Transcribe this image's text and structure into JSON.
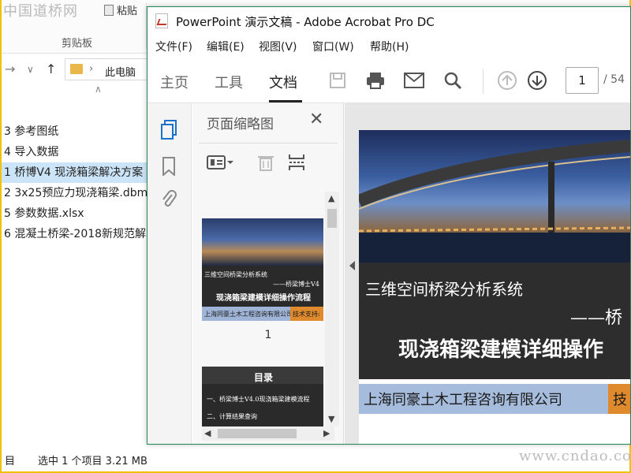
{
  "explorer": {
    "watermark_top": "中国道桥网",
    "ribbon_paste": "粘贴",
    "ribbon_group": "剪贴板",
    "address_path": "此电脑",
    "files": [
      {
        "name": "3 参考图纸",
        "selected": false
      },
      {
        "name": "4 导入数据",
        "selected": false
      },
      {
        "name": "1 桥博V4 现浇箱梁解决方案",
        "selected": true
      },
      {
        "name": "2 3x25预应力现浇箱梁.dbm",
        "selected": false
      },
      {
        "name": "5 参数数据.xlsx",
        "selected": false
      },
      {
        "name": "6 混凝土桥梁-2018新规范解",
        "selected": false
      }
    ],
    "status_left": "目",
    "status_selection": "选中 1 个项目  3.21 MB",
    "watermark_bottom": "www.cndao.com"
  },
  "acrobat": {
    "title": "PowerPoint 演示文稿 - Adobe Acrobat Pro DC",
    "menu": [
      "文件(F)",
      "编辑(E)",
      "视图(V)",
      "窗口(W)",
      "帮助(H)"
    ],
    "tabs": [
      {
        "label": "主页",
        "active": false
      },
      {
        "label": "工具",
        "active": false
      },
      {
        "label": "文档",
        "active": true
      }
    ],
    "page_current": "1",
    "page_total": "/ 54",
    "thumb_panel_title": "页面缩略图",
    "thumbnails": [
      {
        "page_label": "1",
        "line1": "三维空间桥梁分析系统",
        "line2": "——桥梁博士V4",
        "line3": "现浇箱梁建模详细操作流程",
        "company": "上海同豪土木工程咨询有限公司",
        "support": "技术支持:"
      },
      {
        "heading": "目录",
        "item1": "一、桥梁博士V4.0现浇箱梁建模流程",
        "item2": "二、计算结果查询"
      }
    ],
    "slide": {
      "line1": "三维空间桥梁分析系统",
      "line2": "——桥",
      "line3": "现浇箱梁建模详细操作",
      "company": "上海同豪土木工程咨询有限公司",
      "support_fragment": "技"
    }
  }
}
